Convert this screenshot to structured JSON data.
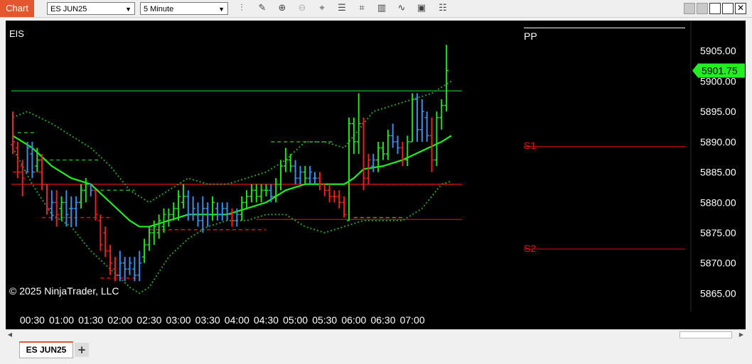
{
  "app": {
    "title": "Chart"
  },
  "toolbar": {
    "instrument": "ES JUN25",
    "interval": "5 Minute",
    "tools": [
      "bar-type-icon",
      "drawing-tool-icon",
      "zoom-in-icon",
      "zoom-out-icon",
      "crosshair-icon",
      "properties-icon",
      "indicators-icon",
      "strategies-icon",
      "chart-trader-icon",
      "more-icon"
    ]
  },
  "chart": {
    "label": "EIS",
    "copyright": "© 2025 NinjaTrader, LLC",
    "last_price": "5901.75",
    "colors": {
      "up": "#22dd22",
      "down": "#ee2020",
      "neutral": "#3a8ee6",
      "ma": "#22ee22",
      "band": "#2a9a2a",
      "pivot_r": "#dd1111",
      "pivot_g": "#22cc22",
      "price_tag": "#22ee22"
    },
    "price_labels": [
      "5905.00",
      "5900.00",
      "5895.00",
      "5890.00",
      "5885.00",
      "5880.00",
      "5875.00",
      "5870.00",
      "5865.00"
    ],
    "time_labels": [
      "00:30",
      "01:00",
      "01:30",
      "02:00",
      "02:30",
      "03:00",
      "03:30",
      "04:00",
      "04:30",
      "05:00",
      "05:30",
      "06:00",
      "06:30",
      "07:00"
    ],
    "pivot_labels": {
      "pp": "PP",
      "s1": "S1",
      "s2": "S2"
    }
  },
  "chart_data": {
    "type": "ohlc",
    "y_range": [
      5862,
      5910
    ],
    "bars_start": "00:10",
    "bar_minutes": 5,
    "pivots": {
      "PP": 5898.4,
      "S1": 5889.2,
      "S2": 5872.3
    },
    "bars": [
      {
        "o": 5889.5,
        "h": 5895,
        "l": 5888,
        "c": 5890,
        "d": "down"
      },
      {
        "o": 5889,
        "h": 5890,
        "l": 5884,
        "c": 5885,
        "d": "down"
      },
      {
        "o": 5886,
        "h": 5887,
        "l": 5881,
        "c": 5884,
        "d": "down"
      },
      {
        "o": 5885,
        "h": 5890,
        "l": 5885,
        "c": 5889,
        "d": "neutral"
      },
      {
        "o": 5888,
        "h": 5890,
        "l": 5884,
        "c": 5885,
        "d": "neutral"
      },
      {
        "o": 5886,
        "h": 5889,
        "l": 5885,
        "c": 5888,
        "d": "up"
      },
      {
        "o": 5887,
        "h": 5888,
        "l": 5882,
        "c": 5883,
        "d": "down"
      },
      {
        "o": 5883,
        "h": 5883,
        "l": 5878,
        "c": 5879,
        "d": "down"
      },
      {
        "o": 5879,
        "h": 5882,
        "l": 5877,
        "c": 5880,
        "d": "neutral"
      },
      {
        "o": 5880,
        "h": 5882,
        "l": 5876,
        "c": 5878,
        "d": "down"
      },
      {
        "o": 5879,
        "h": 5881,
        "l": 5877,
        "c": 5880,
        "d": "up"
      },
      {
        "o": 5880,
        "h": 5882,
        "l": 5876,
        "c": 5878,
        "d": "neutral"
      },
      {
        "o": 5879,
        "h": 5881,
        "l": 5876,
        "c": 5879,
        "d": "neutral"
      },
      {
        "o": 5879,
        "h": 5881,
        "l": 5876,
        "c": 5880,
        "d": "neutral"
      },
      {
        "o": 5880,
        "h": 5883,
        "l": 5879,
        "c": 5882,
        "d": "up"
      },
      {
        "o": 5882,
        "h": 5884,
        "l": 5880,
        "c": 5883,
        "d": "up"
      },
      {
        "o": 5883,
        "h": 5883,
        "l": 5881,
        "c": 5882,
        "d": "neutral"
      },
      {
        "o": 5882,
        "h": 5882,
        "l": 5877,
        "c": 5878,
        "d": "down"
      },
      {
        "o": 5877,
        "h": 5878,
        "l": 5872,
        "c": 5873,
        "d": "down"
      },
      {
        "o": 5875,
        "h": 5876,
        "l": 5871,
        "c": 5872,
        "d": "down"
      },
      {
        "o": 5872,
        "h": 5873,
        "l": 5868,
        "c": 5870,
        "d": "down"
      },
      {
        "o": 5869,
        "h": 5871,
        "l": 5867,
        "c": 5868,
        "d": "down"
      },
      {
        "o": 5868,
        "h": 5872,
        "l": 5867,
        "c": 5870,
        "d": "neutral"
      },
      {
        "o": 5870,
        "h": 5871,
        "l": 5867,
        "c": 5869,
        "d": "neutral"
      },
      {
        "o": 5869,
        "h": 5871,
        "l": 5868,
        "c": 5870,
        "d": "neutral"
      },
      {
        "o": 5869,
        "h": 5871,
        "l": 5867,
        "c": 5868,
        "d": "neutral"
      },
      {
        "o": 5868,
        "h": 5872,
        "l": 5867,
        "c": 5870,
        "d": "neutral"
      },
      {
        "o": 5871,
        "h": 5874,
        "l": 5870,
        "c": 5873,
        "d": "up"
      },
      {
        "o": 5873,
        "h": 5876,
        "l": 5872,
        "c": 5875,
        "d": "up"
      },
      {
        "o": 5875,
        "h": 5877,
        "l": 5873,
        "c": 5876,
        "d": "up"
      },
      {
        "o": 5875,
        "h": 5878,
        "l": 5874,
        "c": 5877,
        "d": "up"
      },
      {
        "o": 5876,
        "h": 5879,
        "l": 5875,
        "c": 5878,
        "d": "up"
      },
      {
        "o": 5877,
        "h": 5879,
        "l": 5876,
        "c": 5878,
        "d": "up"
      },
      {
        "o": 5878,
        "h": 5880,
        "l": 5877,
        "c": 5879,
        "d": "up"
      },
      {
        "o": 5879,
        "h": 5882,
        "l": 5877,
        "c": 5881,
        "d": "up"
      },
      {
        "o": 5880,
        "h": 5883,
        "l": 5879,
        "c": 5881,
        "d": "up"
      },
      {
        "o": 5881,
        "h": 5882,
        "l": 5877,
        "c": 5878,
        "d": "neutral"
      },
      {
        "o": 5878,
        "h": 5881,
        "l": 5877,
        "c": 5879,
        "d": "neutral"
      },
      {
        "o": 5878,
        "h": 5880,
        "l": 5876,
        "c": 5877,
        "d": "neutral"
      },
      {
        "o": 5877,
        "h": 5881,
        "l": 5875,
        "c": 5879,
        "d": "neutral"
      },
      {
        "o": 5879,
        "h": 5880,
        "l": 5876,
        "c": 5878,
        "d": "neutral"
      },
      {
        "o": 5878,
        "h": 5881,
        "l": 5877,
        "c": 5880,
        "d": "up"
      },
      {
        "o": 5879,
        "h": 5880,
        "l": 5877,
        "c": 5878,
        "d": "neutral"
      },
      {
        "o": 5878,
        "h": 5880,
        "l": 5877,
        "c": 5879,
        "d": "neutral"
      },
      {
        "o": 5879,
        "h": 5880,
        "l": 5877,
        "c": 5878,
        "d": "neutral"
      },
      {
        "o": 5878,
        "h": 5879,
        "l": 5876,
        "c": 5877,
        "d": "down"
      },
      {
        "o": 5877,
        "h": 5879,
        "l": 5876,
        "c": 5878,
        "d": "neutral"
      },
      {
        "o": 5878,
        "h": 5881,
        "l": 5877,
        "c": 5880,
        "d": "up"
      },
      {
        "o": 5880,
        "h": 5882,
        "l": 5879,
        "c": 5881,
        "d": "up"
      },
      {
        "o": 5881,
        "h": 5883,
        "l": 5880,
        "c": 5882,
        "d": "up"
      },
      {
        "o": 5882,
        "h": 5883,
        "l": 5880,
        "c": 5881,
        "d": "up"
      },
      {
        "o": 5881,
        "h": 5883,
        "l": 5880,
        "c": 5882,
        "d": "up"
      },
      {
        "o": 5882,
        "h": 5883,
        "l": 5881,
        "c": 5882,
        "d": "up"
      },
      {
        "o": 5882,
        "h": 5883,
        "l": 5880,
        "c": 5881,
        "d": "neutral"
      },
      {
        "o": 5881,
        "h": 5884,
        "l": 5880,
        "c": 5883,
        "d": "up"
      },
      {
        "o": 5883,
        "h": 5887,
        "l": 5882,
        "c": 5886,
        "d": "up"
      },
      {
        "o": 5886,
        "h": 5889,
        "l": 5885,
        "c": 5887,
        "d": "up"
      },
      {
        "o": 5887,
        "h": 5888,
        "l": 5885,
        "c": 5886,
        "d": "up"
      },
      {
        "o": 5886,
        "h": 5887,
        "l": 5883,
        "c": 5884,
        "d": "neutral"
      },
      {
        "o": 5884,
        "h": 5886,
        "l": 5883,
        "c": 5885,
        "d": "neutral"
      },
      {
        "o": 5885,
        "h": 5886,
        "l": 5883,
        "c": 5884,
        "d": "up"
      },
      {
        "o": 5884,
        "h": 5886,
        "l": 5883,
        "c": 5885,
        "d": "neutral"
      },
      {
        "o": 5884,
        "h": 5885,
        "l": 5883,
        "c": 5884,
        "d": "neutral"
      },
      {
        "o": 5884,
        "h": 5885,
        "l": 5882,
        "c": 5883,
        "d": "down"
      },
      {
        "o": 5883,
        "h": 5883,
        "l": 5881,
        "c": 5882,
        "d": "down"
      },
      {
        "o": 5882,
        "h": 5883,
        "l": 5880,
        "c": 5881,
        "d": "down"
      },
      {
        "o": 5881,
        "h": 5882,
        "l": 5880,
        "c": 5881,
        "d": "down"
      },
      {
        "o": 5881,
        "h": 5882,
        "l": 5879,
        "c": 5880,
        "d": "down"
      },
      {
        "o": 5880,
        "h": 5881,
        "l": 5877.5,
        "c": 5878,
        "d": "down"
      },
      {
        "o": 5877,
        "h": 5894,
        "l": 5877,
        "c": 5893,
        "d": "up"
      },
      {
        "o": 5893,
        "h": 5894,
        "l": 5888,
        "c": 5890,
        "d": "up"
      },
      {
        "o": 5890,
        "h": 5898,
        "l": 5888,
        "c": 5893,
        "d": "up"
      },
      {
        "o": 5893,
        "h": 5894,
        "l": 5882,
        "c": 5884,
        "d": "down"
      },
      {
        "o": 5884,
        "h": 5888,
        "l": 5883,
        "c": 5887,
        "d": "down"
      },
      {
        "o": 5886,
        "h": 5888,
        "l": 5885,
        "c": 5887,
        "d": "neutral"
      },
      {
        "o": 5887,
        "h": 5890,
        "l": 5885,
        "c": 5889,
        "d": "up"
      },
      {
        "o": 5889,
        "h": 5890,
        "l": 5887,
        "c": 5888,
        "d": "up"
      },
      {
        "o": 5888,
        "h": 5892,
        "l": 5887,
        "c": 5891,
        "d": "up"
      },
      {
        "o": 5891,
        "h": 5893,
        "l": 5889,
        "c": 5890,
        "d": "neutral"
      },
      {
        "o": 5890,
        "h": 5891,
        "l": 5888,
        "c": 5889,
        "d": "neutral"
      },
      {
        "o": 5889,
        "h": 5890,
        "l": 5886,
        "c": 5887,
        "d": "down"
      },
      {
        "o": 5887,
        "h": 5891,
        "l": 5886,
        "c": 5890,
        "d": "up"
      },
      {
        "o": 5890,
        "h": 5898,
        "l": 5890,
        "c": 5897,
        "d": "up"
      },
      {
        "o": 5897,
        "h": 5898,
        "l": 5890,
        "c": 5892,
        "d": "neutral"
      },
      {
        "o": 5892,
        "h": 5897,
        "l": 5890,
        "c": 5895,
        "d": "neutral"
      },
      {
        "o": 5894,
        "h": 5895,
        "l": 5890,
        "c": 5891,
        "d": "neutral"
      },
      {
        "o": 5891,
        "h": 5894,
        "l": 5885,
        "c": 5887,
        "d": "down"
      },
      {
        "o": 5887,
        "h": 5895,
        "l": 5886,
        "c": 5894,
        "d": "up"
      },
      {
        "o": 5894,
        "h": 5897,
        "l": 5892,
        "c": 5896,
        "d": "up"
      },
      {
        "o": 5896,
        "h": 5906,
        "l": 5895,
        "c": 5901.75,
        "d": "up"
      }
    ],
    "ma": [
      [
        0,
        5891
      ],
      [
        4,
        5889
      ],
      [
        8,
        5886
      ],
      [
        12,
        5884
      ],
      [
        16,
        5883
      ],
      [
        20,
        5880
      ],
      [
        24,
        5877
      ],
      [
        26,
        5876
      ],
      [
        28,
        5876
      ],
      [
        32,
        5877
      ],
      [
        36,
        5878
      ],
      [
        40,
        5878
      ],
      [
        44,
        5878
      ],
      [
        48,
        5879
      ],
      [
        52,
        5880
      ],
      [
        56,
        5882
      ],
      [
        60,
        5883
      ],
      [
        64,
        5883
      ],
      [
        68,
        5883
      ],
      [
        70,
        5884
      ],
      [
        72,
        5885.5
      ],
      [
        76,
        5886
      ],
      [
        80,
        5887
      ],
      [
        84,
        5888.5
      ],
      [
        88,
        5890
      ],
      [
        90,
        5891
      ]
    ],
    "band_upper": [
      [
        0,
        5894
      ],
      [
        3,
        5895
      ],
      [
        8,
        5893
      ],
      [
        12,
        5891
      ],
      [
        16,
        5889
      ],
      [
        20,
        5886
      ],
      [
        24,
        5882
      ],
      [
        28,
        5880
      ],
      [
        32,
        5882
      ],
      [
        36,
        5884
      ],
      [
        40,
        5883
      ],
      [
        44,
        5883
      ],
      [
        48,
        5884
      ],
      [
        52,
        5885
      ],
      [
        56,
        5887
      ],
      [
        60,
        5890
      ],
      [
        64,
        5890
      ],
      [
        68,
        5889
      ],
      [
        70,
        5891
      ],
      [
        74,
        5895
      ],
      [
        78,
        5896
      ],
      [
        82,
        5897
      ],
      [
        86,
        5898
      ],
      [
        90,
        5900
      ]
    ],
    "band_lower": [
      [
        0,
        5889
      ],
      [
        4,
        5883
      ],
      [
        8,
        5878
      ],
      [
        12,
        5876
      ],
      [
        16,
        5872
      ],
      [
        20,
        5869
      ],
      [
        24,
        5866
      ],
      [
        26,
        5865
      ],
      [
        28,
        5866
      ],
      [
        32,
        5871
      ],
      [
        36,
        5874
      ],
      [
        40,
        5876
      ],
      [
        44,
        5877
      ],
      [
        48,
        5877
      ],
      [
        52,
        5878
      ],
      [
        56,
        5878
      ],
      [
        60,
        5876
      ],
      [
        64,
        5875
      ],
      [
        68,
        5876
      ],
      [
        72,
        5877
      ],
      [
        76,
        5877
      ],
      [
        80,
        5877
      ],
      [
        84,
        5879
      ],
      [
        88,
        5883
      ],
      [
        90,
        5883.5
      ]
    ],
    "dashed_levels": [
      {
        "price": 5891.5,
        "from": 1,
        "to": 5,
        "c": "up"
      },
      {
        "price": 5887,
        "from": 5,
        "to": 18,
        "c": "up"
      },
      {
        "price": 5885,
        "from": 0,
        "to": 6,
        "c": "down"
      },
      {
        "price": 5882,
        "from": 18,
        "to": 25,
        "c": "up"
      },
      {
        "price": 5877.5,
        "from": 6,
        "to": 20,
        "c": "down"
      },
      {
        "price": 5875.5,
        "from": 28,
        "to": 52,
        "c": "down"
      },
      {
        "price": 5867.5,
        "from": 18,
        "to": 26,
        "c": "down"
      },
      {
        "price": 5890,
        "from": 53,
        "to": 66,
        "c": "up"
      },
      {
        "price": 5883,
        "from": 70,
        "to": 91,
        "c": "down"
      },
      {
        "price": 5877.5,
        "from": 70,
        "to": 80,
        "c": "up"
      }
    ],
    "solid_levels": [
      {
        "price": 5898.4,
        "from": -1,
        "to": 91,
        "c": "up"
      },
      {
        "price": 5883,
        "from": -1,
        "to": 91,
        "c": "down"
      },
      {
        "price": 5877.2,
        "from": 50,
        "to": 91,
        "c": "down"
      }
    ]
  },
  "tabs": {
    "active": "ES JUN25",
    "add": "+"
  }
}
